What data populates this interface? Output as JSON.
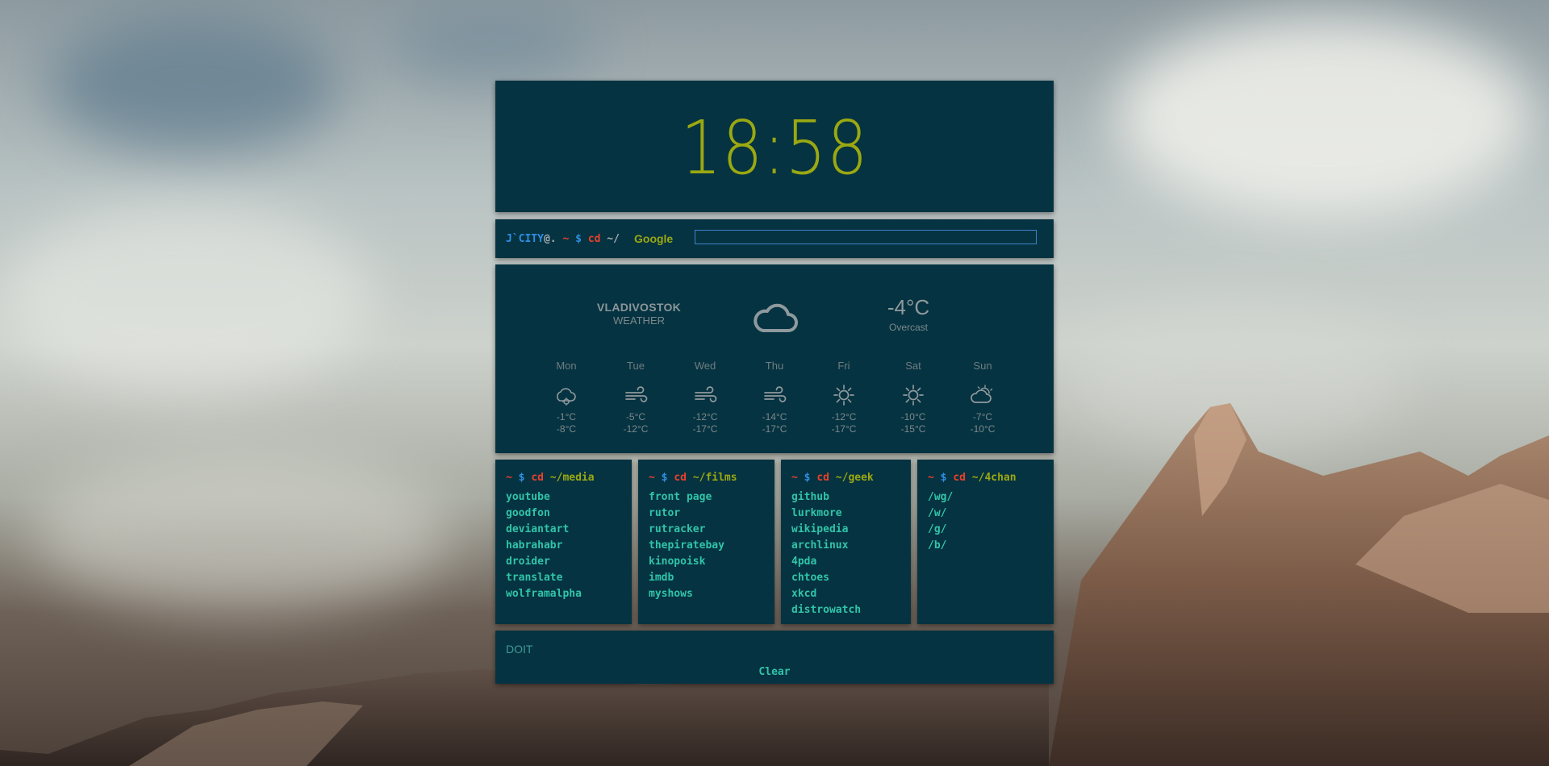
{
  "clock": {
    "time": "18:58"
  },
  "prompt": {
    "user": "J`CITY",
    "at": "@.",
    "tilde": "~",
    "dollar": "$",
    "cmd": "cd",
    "path": "~/",
    "search_label": "Google",
    "search_value": ""
  },
  "weather": {
    "city": "VLADIVOSTOK",
    "subtitle": "WEATHER",
    "current_icon": "cloud-icon",
    "temperature": "-4°C",
    "condition": "Overcast",
    "days": [
      {
        "name": "Mon",
        "icon": "cloud-sun-icon",
        "high": "-1°C",
        "low": "-8°C"
      },
      {
        "name": "Tue",
        "icon": "wind-icon",
        "high": "-5°C",
        "low": "-12°C"
      },
      {
        "name": "Wed",
        "icon": "wind-icon",
        "high": "-12°C",
        "low": "-17°C"
      },
      {
        "name": "Thu",
        "icon": "wind-icon",
        "high": "-14°C",
        "low": "-17°C"
      },
      {
        "name": "Fri",
        "icon": "sun-icon",
        "high": "-12°C",
        "low": "-17°C"
      },
      {
        "name": "Sat",
        "icon": "sun-icon",
        "high": "-10°C",
        "low": "-15°C"
      },
      {
        "name": "Sun",
        "icon": "partly-cloudy-icon",
        "high": "-7°C",
        "low": "-10°C"
      }
    ]
  },
  "links": [
    {
      "tilde": "~",
      "dollar": "$",
      "cmd": "cd",
      "path": "~/media",
      "items": [
        "youtube",
        "goodfon",
        "deviantart",
        "habrahabr",
        "droider",
        "translate",
        "wolframalpha"
      ]
    },
    {
      "tilde": "~",
      "dollar": "$",
      "cmd": "cd",
      "path": "~/films",
      "items": [
        "front page",
        "rutor",
        "rutracker",
        "thepiratebay",
        "kinopoisk",
        "imdb",
        "myshows"
      ]
    },
    {
      "tilde": "~",
      "dollar": "$",
      "cmd": "cd",
      "path": "~/geek",
      "items": [
        "github",
        "lurkmore",
        "wikipedia",
        "archlinux",
        "4pda",
        "chtoes",
        "xkcd",
        "distrowatch"
      ]
    },
    {
      "tilde": "~",
      "dollar": "$",
      "cmd": "cd",
      "path": "~/4chan",
      "items": [
        "/wg/",
        "/w/",
        "/g/",
        "/b/"
      ]
    }
  ],
  "todo": {
    "placeholder": "DOIT",
    "clear_label": "Clear"
  },
  "colors": {
    "panel": "#063341",
    "clock": "#9aa812",
    "link": "#31c4a8",
    "prompt_red": "#e8412c",
    "prompt_blue": "#2e8ee2",
    "search_border": "#3e83cf"
  }
}
